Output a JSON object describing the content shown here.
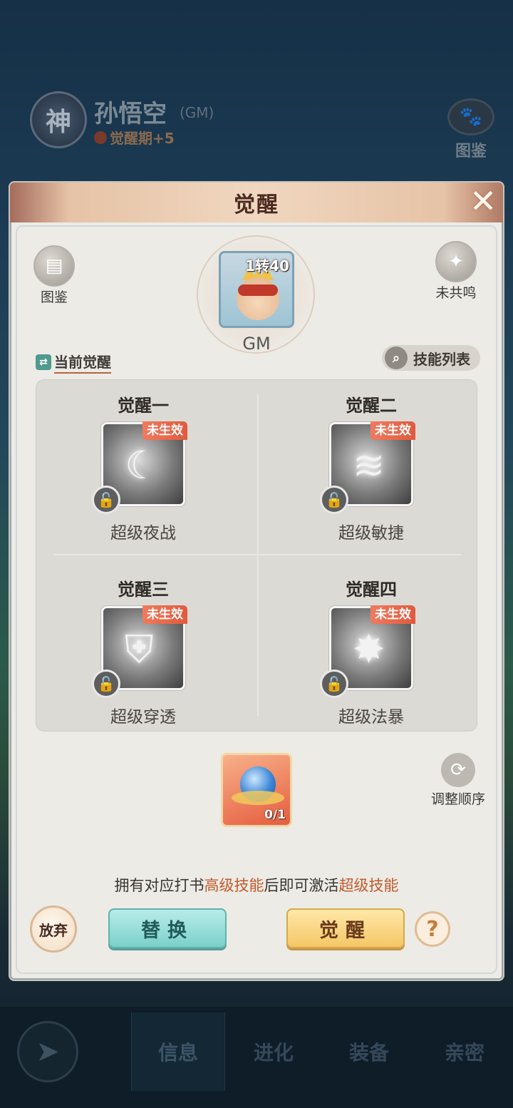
{
  "background": {
    "rank_badge": "神",
    "hero_name": "孙悟空",
    "hero_tag": "(GM)",
    "stage": "觉醒期+5",
    "codex_label": "图鉴"
  },
  "nav": {
    "tabs": [
      "信息",
      "进化",
      "装备",
      "亲密"
    ],
    "active": "信息"
  },
  "dialog": {
    "title": "觉醒",
    "close_icon": "close-icon",
    "left_corner_label": "图鉴",
    "right_corner_label": "未共鸣",
    "portrait_level": "1转40",
    "portrait_name": "GM",
    "current_label": "当前觉醒",
    "skill_list_label": "技能列表",
    "awakenings": [
      {
        "title": "觉醒一",
        "status": "未生效",
        "skill": "超级夜战",
        "icon": "moon-icon"
      },
      {
        "title": "觉醒二",
        "status": "未生效",
        "skill": "超级敏捷",
        "icon": "claw-icon"
      },
      {
        "title": "觉醒三",
        "status": "未生效",
        "skill": "超级穿透",
        "icon": "shield-pierce-icon"
      },
      {
        "title": "觉醒四",
        "status": "未生效",
        "skill": "超级法暴",
        "icon": "burst-icon"
      }
    ],
    "item_count": "0/1",
    "adjust_label": "调整顺序",
    "hint": {
      "p1": "拥有对应打书",
      "h1": "高级技能",
      "p2": "后即可激活",
      "h2": "超级技能"
    },
    "abandon_label": "放弃",
    "replace_label": "替换",
    "awaken_label": "觉醒",
    "help_label": "?"
  },
  "colors": {
    "highlight": "#c25a2a",
    "badge": "#e86a4e",
    "panel": "#dcdad5"
  }
}
